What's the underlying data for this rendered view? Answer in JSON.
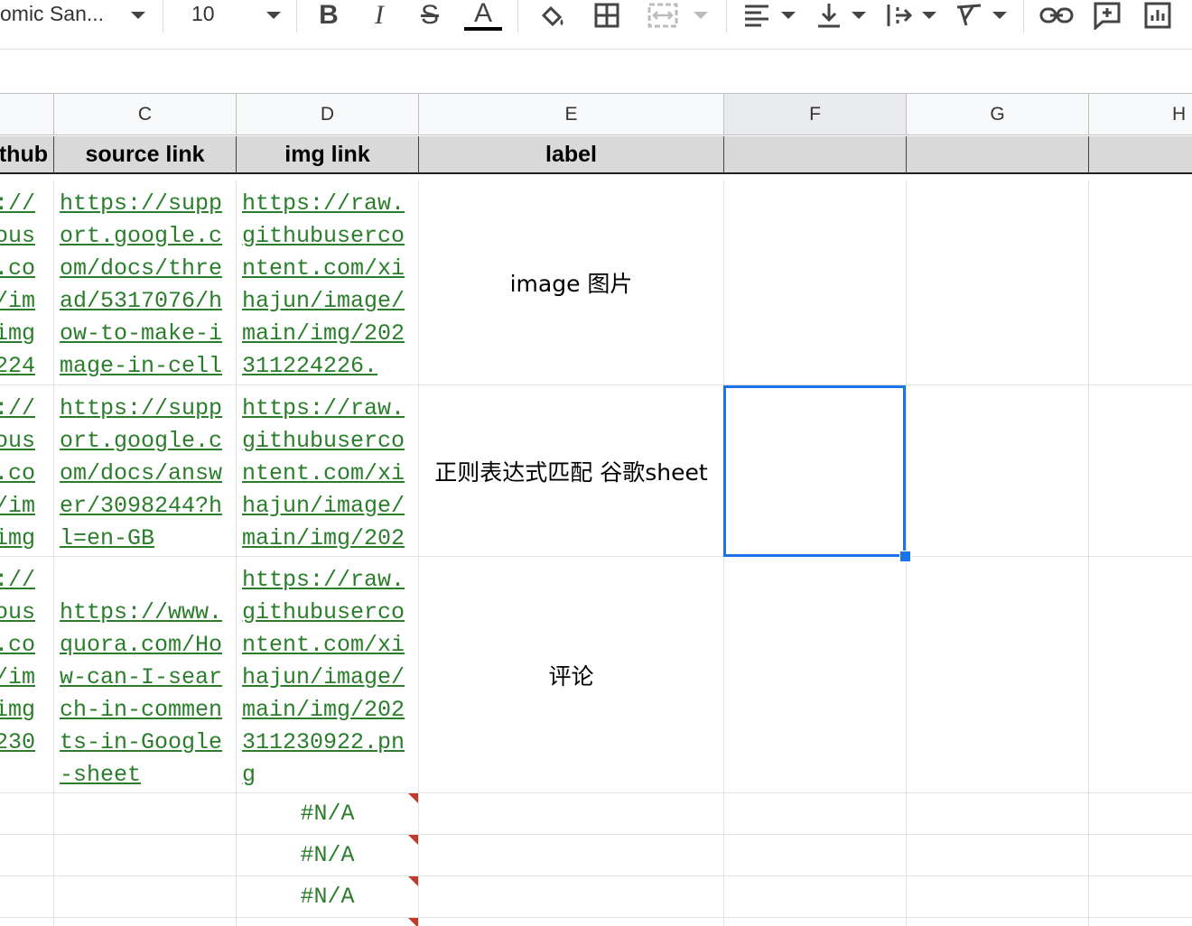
{
  "toolbar": {
    "font_name": "omic San...",
    "font_size": "10",
    "text_color": "#000000"
  },
  "grid": {
    "columns": [
      {
        "letter": ""
      },
      {
        "letter": "C"
      },
      {
        "letter": "D"
      },
      {
        "letter": "E"
      },
      {
        "letter": "F"
      },
      {
        "letter": "G"
      },
      {
        "letter": "H"
      }
    ],
    "headers": [
      "thub",
      "source link",
      "img link",
      "label",
      "",
      "",
      ""
    ],
    "rows": [
      {
        "b": "://\nous\n.co\n/im\nimg\n224",
        "c": "https://support.google.com/docs/thread/5317076/how-to-make-image-in-cell",
        "d": "https://raw.githubusercontent.com/xihajun/image/main/img/20231122​4226.",
        "e": "image 图片"
      },
      {
        "b": "://\nous\n.co\n/im\nimg",
        "c": "https://support.google.com/docs/answer/3098244?hl=en-GB",
        "d": "https://raw.githubusercontent.com/xihajun/image/main/img/202",
        "e": "正则表达式匹配 谷歌sheet"
      },
      {
        "b": "://\nous\n.co\n/im\nimg\n230",
        "c": "https://www.quora.com/How-can-I-search-in-comments-in-Google-sheet",
        "d": "https://raw.githubusercontent.com/xihajun/image/main/img/20231123​0922.png",
        "e": "评论"
      }
    ],
    "na_rows": [
      "#N/A",
      "#N/A",
      "#N/A"
    ]
  },
  "colors": {
    "link": "#2a7d2a",
    "selection": "#1a73e8",
    "header_fill": "#d9d9d9",
    "error_marker": "#c0392b"
  }
}
